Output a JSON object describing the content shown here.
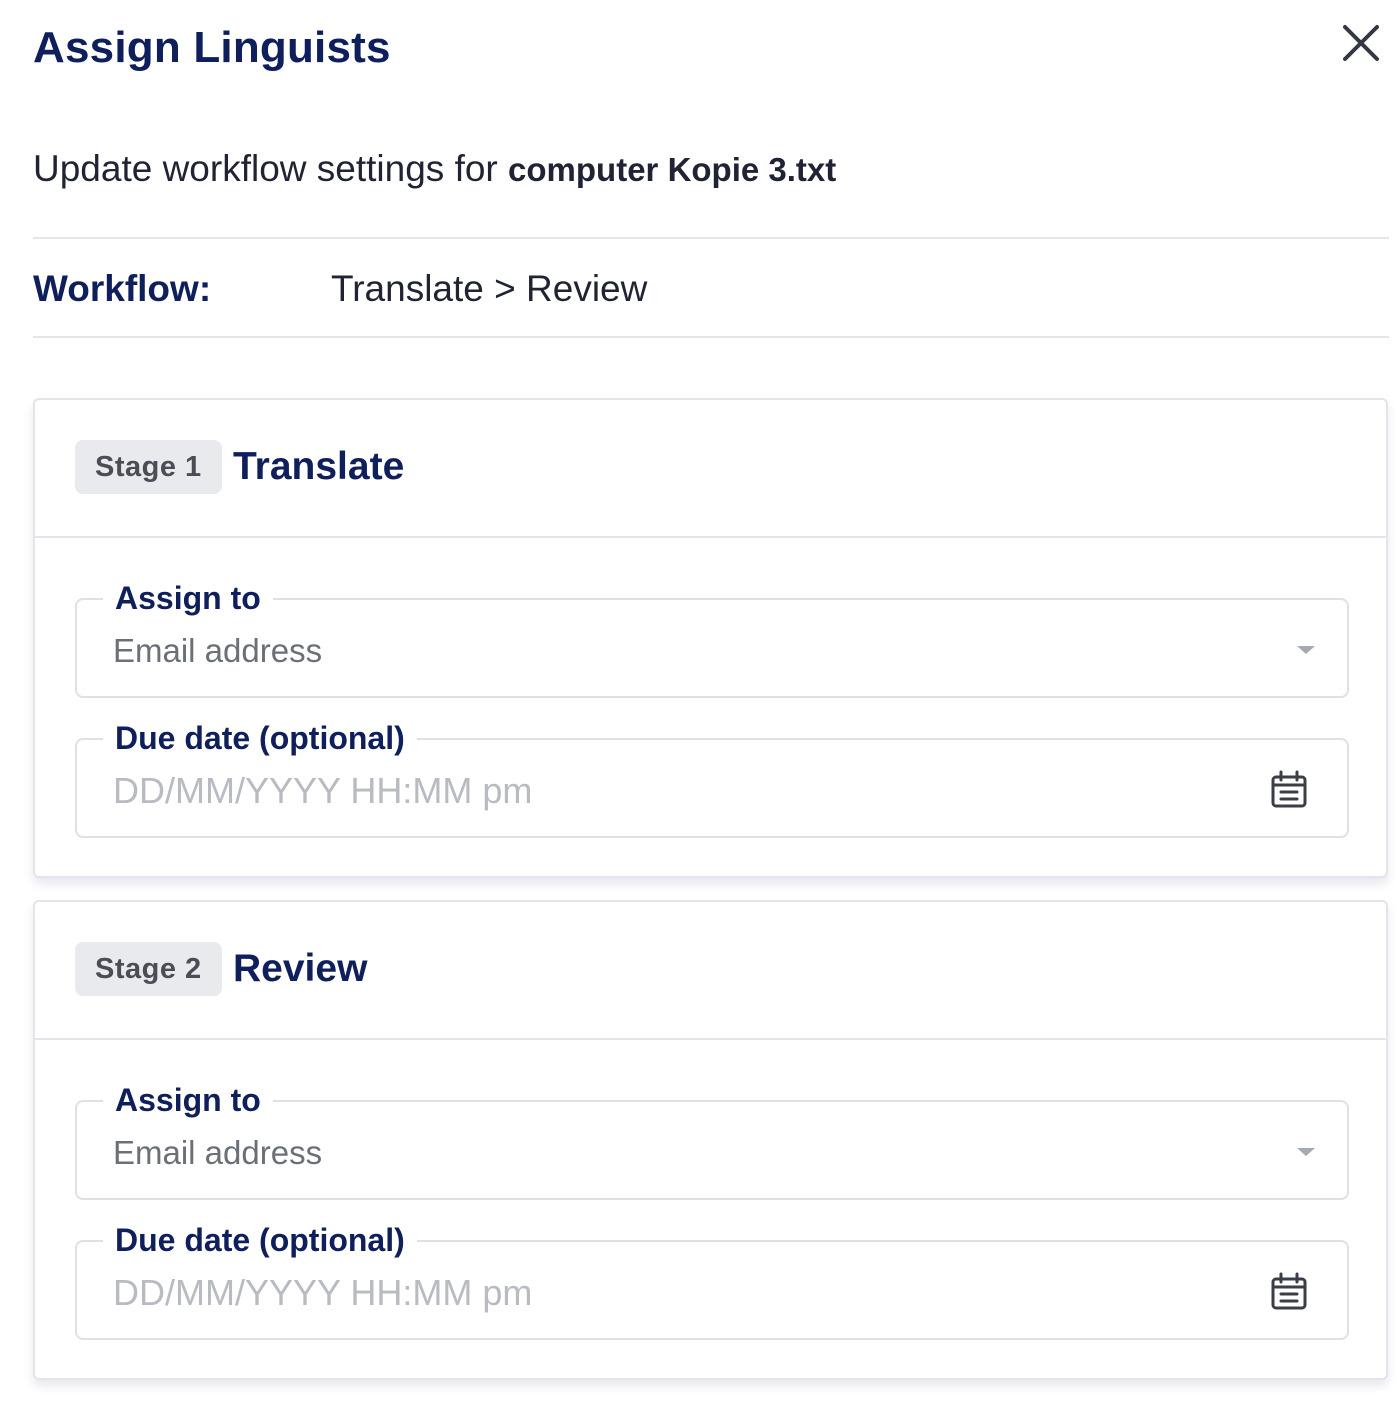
{
  "dialog": {
    "title": "Assign Linguists",
    "close_icon": "close-icon"
  },
  "subtitle": {
    "prefix": "Update workflow settings for ",
    "filename": "computer Kopie 3.txt"
  },
  "workflow": {
    "label": "Workflow:",
    "value": "Translate > Review"
  },
  "stages": [
    {
      "badge": "Stage 1",
      "name": "Translate",
      "assign_label": "Assign to",
      "assign_placeholder": "Email address",
      "due_label": "Due date (optional)",
      "due_placeholder": "DD/MM/YYYY HH:MM pm",
      "dropdown_icon": "caret-down-icon",
      "date_icon": "calendar-icon"
    },
    {
      "badge": "Stage 2",
      "name": "Review",
      "assign_label": "Assign to",
      "assign_placeholder": "Email address",
      "due_label": "Due date (optional)",
      "due_placeholder": "DD/MM/YYYY HH:MM pm",
      "dropdown_icon": "caret-down-icon",
      "date_icon": "calendar-icon"
    }
  ],
  "colors": {
    "title": "#0f1f5c",
    "text": "#1f2333",
    "border": "#e3e5ea",
    "badge_bg": "#e9eaed",
    "placeholder": "#b8bbc2"
  }
}
